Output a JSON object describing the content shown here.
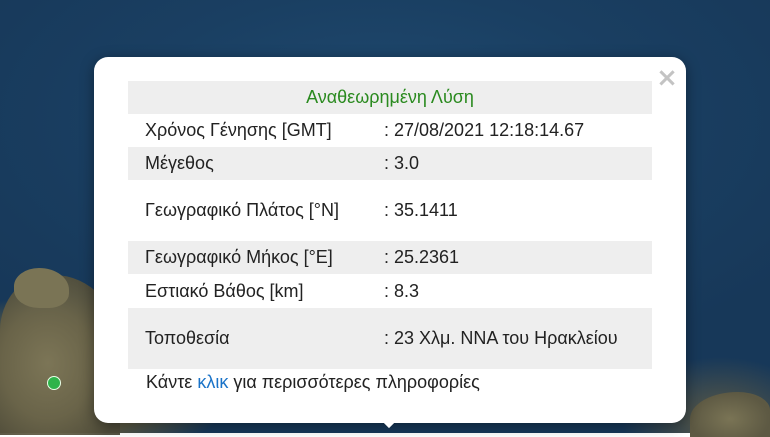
{
  "popup": {
    "title": "Αναθεωρημένη Λύση",
    "close_label": "×",
    "rows": [
      {
        "label": "Χρόνος Γένησης [GMT]",
        "value": ": 27/08/2021 12:18:14.67"
      },
      {
        "label": "Μέγεθος",
        "value": ": 3.0"
      },
      {
        "label": "Γεωγραφικό Πλάτος [°N]",
        "value": ": 35.1411"
      },
      {
        "label": "Γεωγραφικό Μήκος [°E]",
        "value": ": 25.2361"
      },
      {
        "label": "Εστιακό Βάθος [km]",
        "value": ": 8.3"
      },
      {
        "label": "Τοποθεσία",
        "value": ": 23 Χλμ. ΝΝΑ του Ηρακλείου"
      }
    ],
    "footer_before": "Κάντε ",
    "footer_link": "κλικ",
    "footer_after": " για περισσότερες πληροφορίες"
  },
  "colors": {
    "title_green": "#2a8a1f",
    "link_blue": "#1a73c8",
    "marker_green": "#2eb34a"
  }
}
